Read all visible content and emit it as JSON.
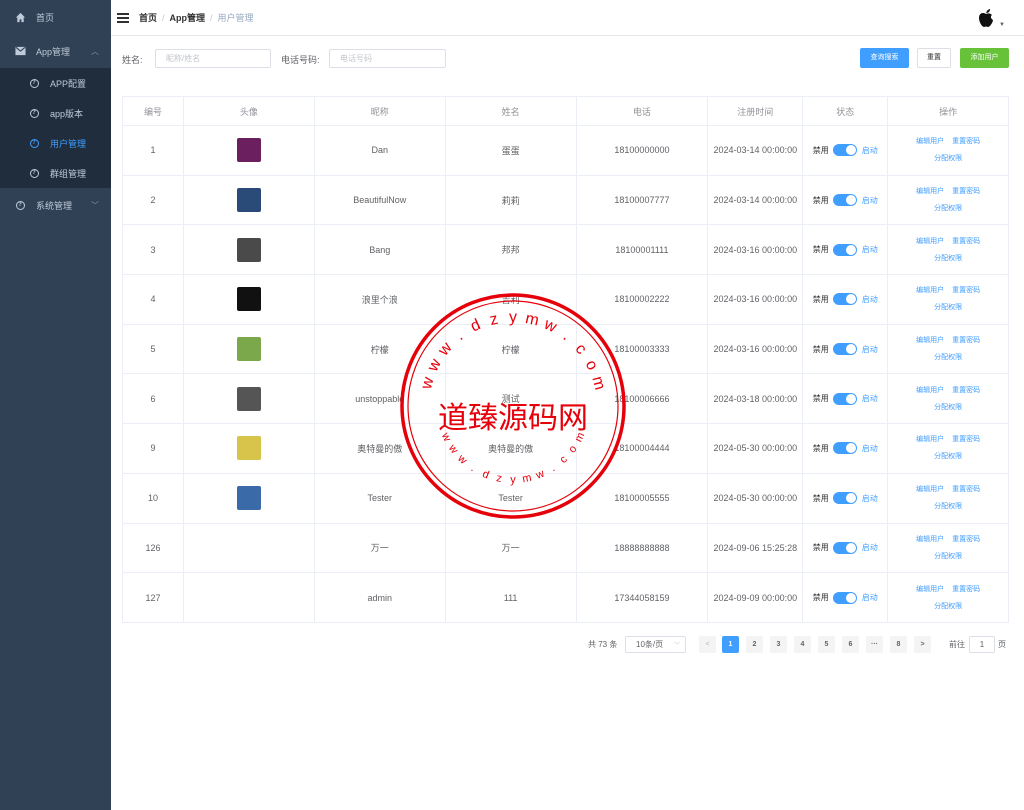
{
  "sidebar": {
    "items": [
      {
        "label": "首页"
      },
      {
        "label": "App管理"
      },
      {
        "label": "APP配置"
      },
      {
        "label": "app版本"
      },
      {
        "label": "用户管理"
      },
      {
        "label": "群组管理"
      },
      {
        "label": "系统管理"
      }
    ]
  },
  "header": {
    "breadcrumb": [
      "首页",
      "App管理",
      "用户管理"
    ],
    "separator": "/"
  },
  "search": {
    "name_label": "姓名:",
    "name_placeholder": "昵称/姓名",
    "phone_label": "电话号码:",
    "phone_placeholder": "电话号码",
    "search_button": "查询搜索",
    "reset_button": "重置",
    "add_button": "添加用户"
  },
  "table": {
    "headers": [
      "编号",
      "头像",
      "昵称",
      "姓名",
      "电话",
      "注册时间",
      "状态",
      "操作"
    ],
    "status_off": "禁用",
    "status_on": "启动",
    "op_edit": "编辑用户",
    "op_reset": "重置密码",
    "op_assign": "分配权限",
    "rows": [
      {
        "id": "1",
        "nickname": "Dan",
        "name": "蛋蛋",
        "phone": "18100000000",
        "time": "2024-03-14 00:00:00",
        "avatar_color": "#6b1f5e"
      },
      {
        "id": "2",
        "nickname": "BeautifulNow",
        "name": "莉莉",
        "phone": "18100007777",
        "time": "2024-03-14 00:00:00",
        "avatar_color": "#2a4a78"
      },
      {
        "id": "3",
        "nickname": "Bang",
        "name": "邦邦",
        "phone": "18100001111",
        "time": "2024-03-16 00:00:00",
        "avatar_color": "#4a4a4a"
      },
      {
        "id": "4",
        "nickname": "浪里个浪",
        "name": "吉利",
        "phone": "18100002222",
        "time": "2024-03-16 00:00:00",
        "avatar_color": "#111111"
      },
      {
        "id": "5",
        "nickname": "柠檬",
        "name": "柠檬",
        "phone": "18100003333",
        "time": "2024-03-16 00:00:00",
        "avatar_color": "#7aa84a"
      },
      {
        "id": "6",
        "nickname": "unstoppable",
        "name": "测试",
        "phone": "18100006666",
        "time": "2024-03-18 00:00:00",
        "avatar_color": "#555555"
      },
      {
        "id": "9",
        "nickname": "奥特曼的傲",
        "name": "奥特曼的傲",
        "phone": "18100004444",
        "time": "2024-05-30 00:00:00",
        "avatar_color": "#d8c44a"
      },
      {
        "id": "10",
        "nickname": "Tester",
        "name": "Tester",
        "phone": "18100005555",
        "time": "2024-05-30 00:00:00",
        "avatar_color": "#3a6aa8"
      },
      {
        "id": "126",
        "nickname": "万一",
        "name": "万一",
        "phone": "18888888888",
        "time": "2024-09-06 15:25:28",
        "avatar_color": ""
      },
      {
        "id": "127",
        "nickname": "admin",
        "name": "111",
        "phone": "17344058159",
        "time": "2024-09-09 00:00:00",
        "avatar_color": ""
      }
    ]
  },
  "pagination": {
    "total": "共 73 条",
    "page_size": "10条/页",
    "prev": "<",
    "next": ">",
    "pages": [
      "1",
      "2",
      "3",
      "4",
      "5",
      "6",
      "···",
      "8"
    ],
    "current": "1",
    "goto_label": "前往",
    "goto_value": "1",
    "goto_suffix": "页"
  },
  "watermark": {
    "center_text": "道臻源码网",
    "ring_text": "w w w . d z y m w . c o m"
  },
  "colors": {
    "sidebar_bg": "#304156",
    "primary": "#409eff",
    "success": "#67c23a",
    "stamp_red": "#e6000a"
  }
}
